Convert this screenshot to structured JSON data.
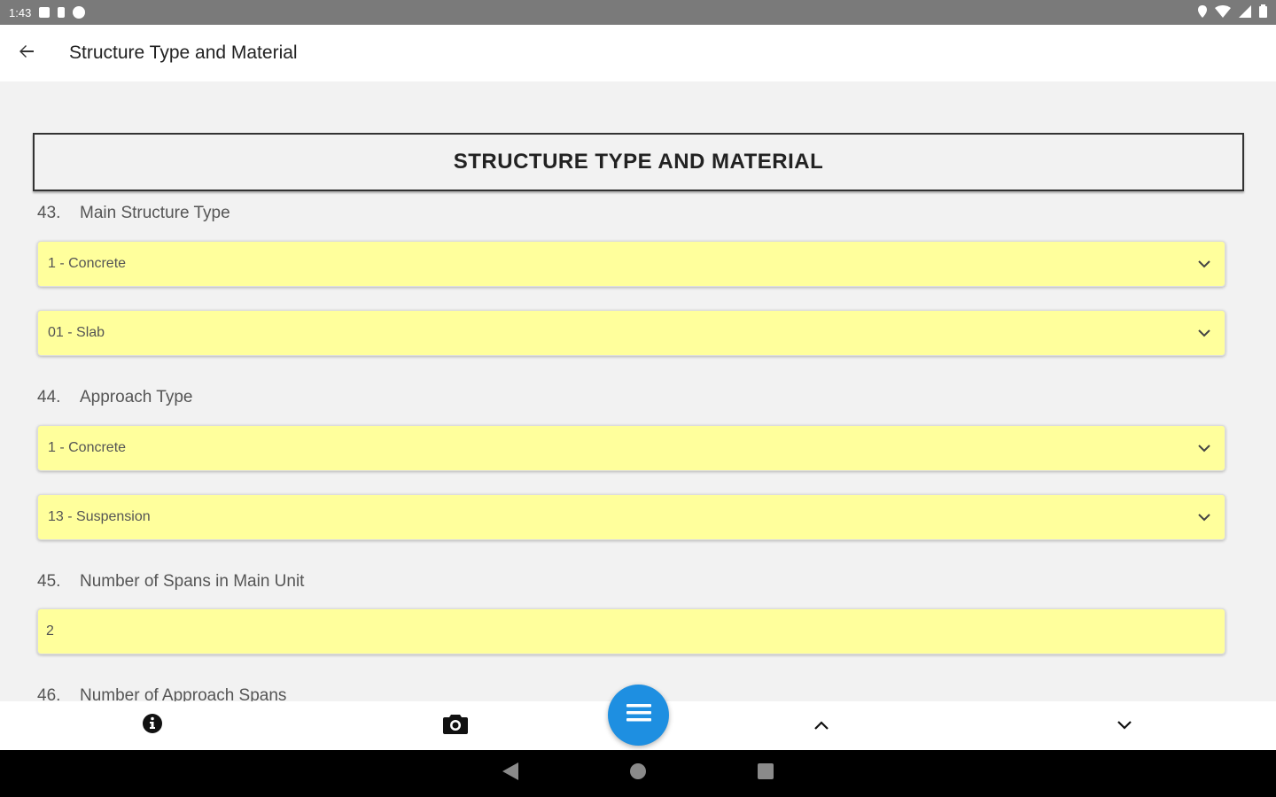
{
  "status_bar": {
    "time": "1:43"
  },
  "app_bar": {
    "title": "Structure Type and Material"
  },
  "section": {
    "heading": "STRUCTURE TYPE AND MATERIAL"
  },
  "fields": [
    {
      "number": "43.",
      "label": "Main Structure Type",
      "values": [
        "1 - Concrete",
        "01 - Slab"
      ]
    },
    {
      "number": "44.",
      "label": "Approach Type",
      "values": [
        "1 - Concrete",
        "13 - Suspension"
      ]
    },
    {
      "number": "45.",
      "label": "Number of Spans in Main Unit",
      "input_value": "2"
    },
    {
      "number": "46.",
      "label": "Number of Approach Spans"
    }
  ],
  "colors": {
    "field_bg": "#ffff9c",
    "fab": "#1e8fe1"
  },
  "icons": {
    "bottom": [
      "info-icon",
      "camera-icon",
      "menu-icon",
      "chevron-up-icon",
      "chevron-down-icon"
    ],
    "nav": [
      "back-triangle-icon",
      "home-circle-icon",
      "recents-square-icon"
    ]
  }
}
